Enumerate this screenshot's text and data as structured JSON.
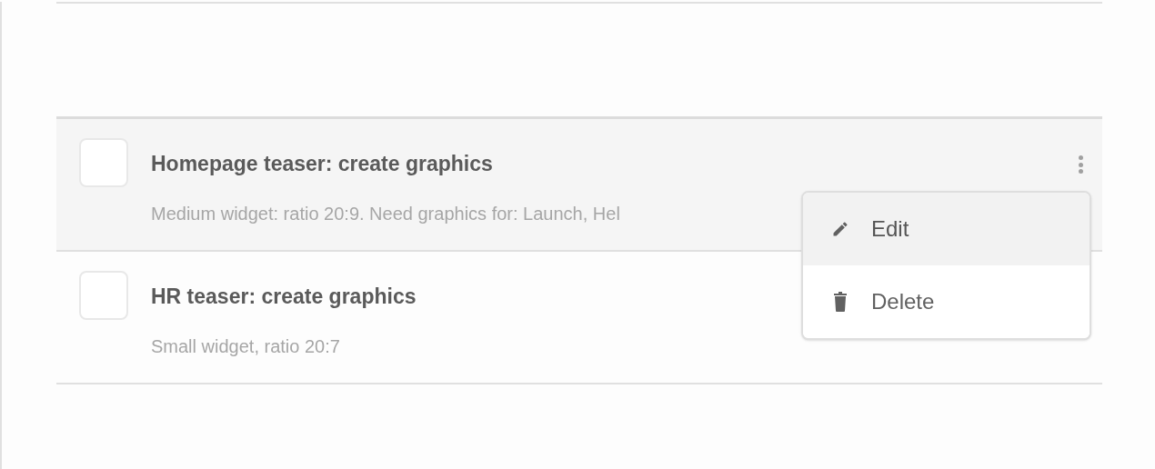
{
  "tasks": [
    {
      "title": "Homepage teaser: create graphics",
      "description": "Medium widget: ratio 20:9. Need graphics for: Launch, Hel",
      "checked": false,
      "highlighted": true,
      "menu_open": true
    },
    {
      "title": "HR teaser: create graphics",
      "description": "Small widget, ratio 20:7",
      "checked": false,
      "highlighted": false,
      "menu_open": false
    }
  ],
  "menu": [
    {
      "kind": "edit",
      "label": "Edit",
      "selected": true
    },
    {
      "kind": "delete",
      "label": "Delete",
      "selected": false
    }
  ]
}
